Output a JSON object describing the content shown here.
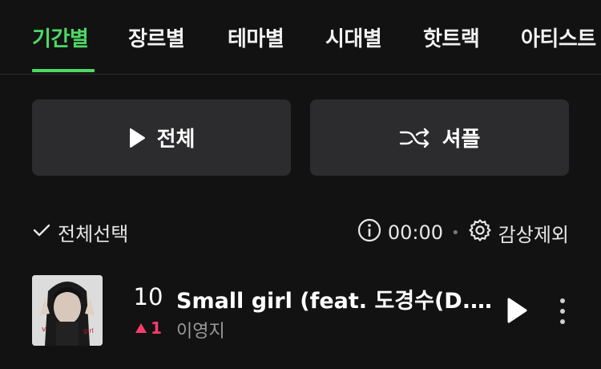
{
  "tabs": [
    {
      "label": "기간별",
      "active": true
    },
    {
      "label": "장르별",
      "active": false
    },
    {
      "label": "테마별",
      "active": false
    },
    {
      "label": "시대별",
      "active": false
    },
    {
      "label": "핫트랙",
      "active": false
    },
    {
      "label": "아티스트",
      "active": false
    }
  ],
  "actions": {
    "play_all_label": "전체",
    "shuffle_label": "셔플"
  },
  "selection": {
    "select_all_label": "전체선택",
    "time": "00:00",
    "exclude_label": "감상제외"
  },
  "track": {
    "rank": "10",
    "change_direction": "up",
    "change_value": "1",
    "title": "Small girl (feat. 도경수(D.O.))",
    "artist": "이영지"
  },
  "colors": {
    "accent": "#4cd964",
    "up": "#ff3b6f",
    "background": "#121212",
    "button": "#2c2c2e"
  }
}
